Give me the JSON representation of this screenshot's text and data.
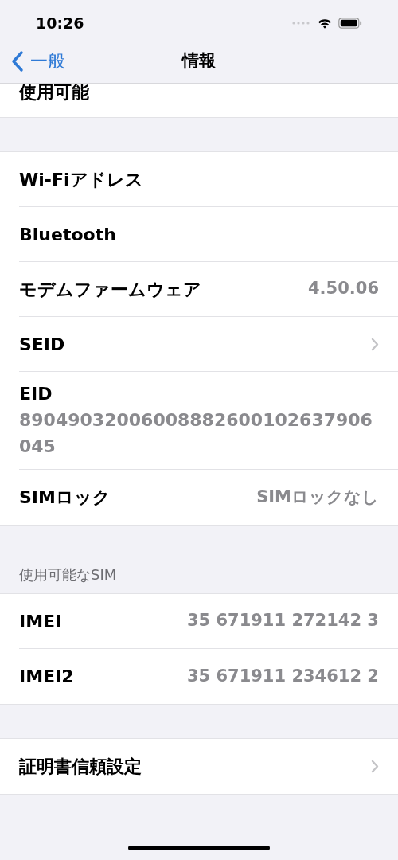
{
  "status_bar": {
    "time": "10:26"
  },
  "nav": {
    "back": "一般",
    "title": "情報"
  },
  "sections": [
    {
      "rows": [
        {
          "kind": "partial",
          "label": "使用可能"
        }
      ]
    },
    {
      "rows": [
        {
          "kind": "value",
          "label": "Wi-Fiアドレス"
        },
        {
          "kind": "value",
          "label": "Bluetooth"
        },
        {
          "kind": "value",
          "label": "モデムファームウェア",
          "value": "4.50.06"
        },
        {
          "kind": "link",
          "label": "SEID"
        },
        {
          "kind": "stacked",
          "label": "EID",
          "value": "89049032006008882600102637906045"
        },
        {
          "kind": "value",
          "label": "SIMロック",
          "value": "SIMロックなし"
        }
      ]
    },
    {
      "header": "使用可能なSIM",
      "rows": [
        {
          "kind": "value",
          "label": "IMEI",
          "value": "35 671911 272142 3"
        },
        {
          "kind": "value",
          "label": "IMEI2",
          "value": "35 671911 234612 2"
        }
      ]
    },
    {
      "rows": [
        {
          "kind": "link",
          "label": "証明書信頼設定"
        }
      ]
    }
  ]
}
